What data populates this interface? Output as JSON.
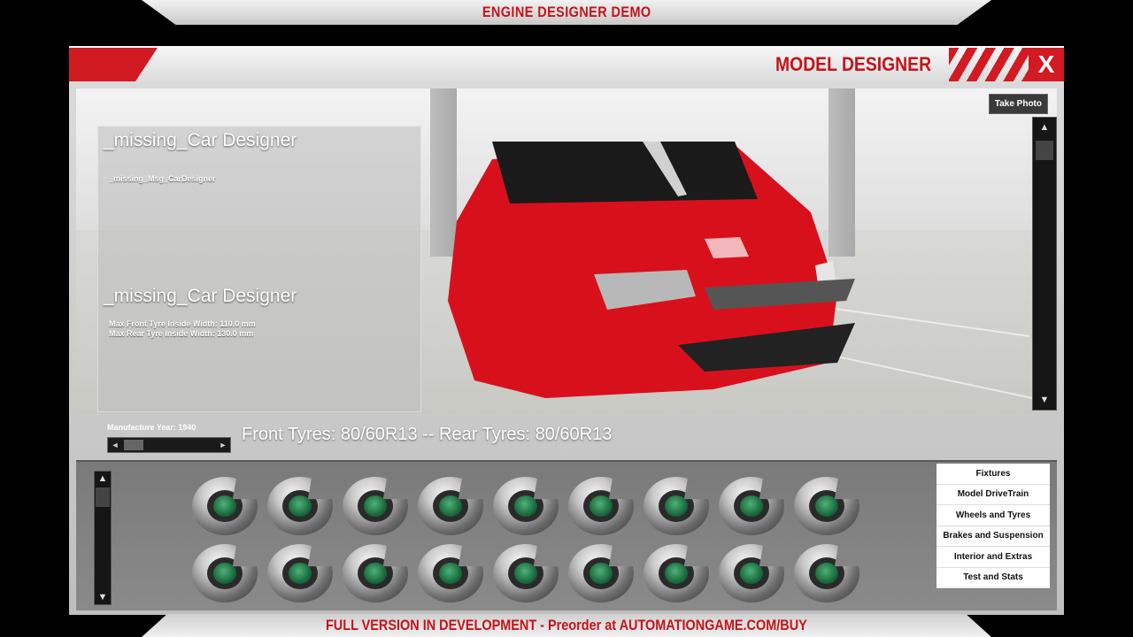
{
  "top_banner": {
    "text": "ENGINE DESIGNER DEMO"
  },
  "window": {
    "title": "MODEL DESIGNER",
    "close_label": "X"
  },
  "viewport": {
    "take_photo_label": "Take Photo",
    "info_top_title": "_missing_Car Designer",
    "info_top_msg": "_missing_Msg_CarDesigner",
    "info_bottom_title": "_missing_Car Designer",
    "info_lines": [
      "Max Front Tyre Inside Width: 110.0 mm",
      "Max Rear Tyre Inside Width: 130.0 mm"
    ],
    "car_color": "#d8101c"
  },
  "status": {
    "year_label": "Manufacture Year: 1940",
    "tyres_text": "Front Tyres: 80/60R13 -- Rear Tyres: 80/60R13"
  },
  "parts": {
    "count": 18,
    "icon": "fixture-part-icon"
  },
  "menu": {
    "items": [
      "Fixtures",
      "Model DriveTrain",
      "Wheels and Tyres",
      "Brakes and Suspension",
      "Interior and Extras",
      "Test and Stats"
    ]
  },
  "bottom_banner": {
    "text": "FULL VERSION IN DEVELOPMENT - Preorder at AUTOMATIONGAME.COM/BUY"
  },
  "icons": {
    "up": "▲",
    "down": "▼",
    "left": "◄",
    "right": "►"
  }
}
